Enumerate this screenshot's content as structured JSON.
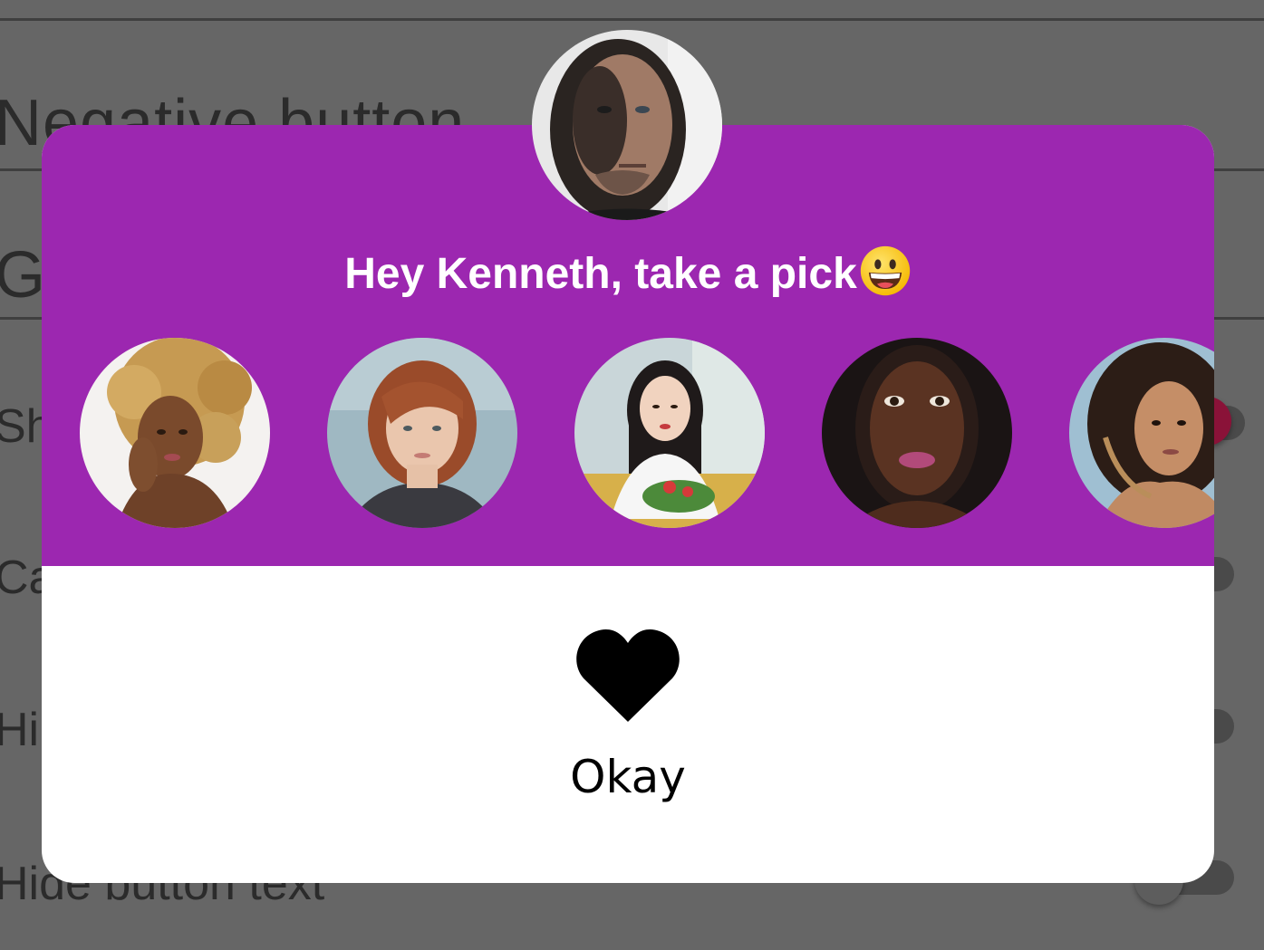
{
  "background": {
    "fields": [
      {
        "text": "Negative button"
      },
      {
        "text": "Go"
      }
    ],
    "rows": [
      {
        "label": "Sh",
        "toggle_on": true
      },
      {
        "label": "Ca",
        "toggle_on": false
      },
      {
        "label": "Hi",
        "toggle_on": false
      },
      {
        "label": "Hide button text",
        "toggle_on": false
      }
    ]
  },
  "dialog": {
    "header_color": "#9c27b0",
    "avatar_icon": "man-portrait",
    "title": "Hey Kenneth, take a pick",
    "title_emoji": "grinning-face-emoji",
    "choices": [
      {
        "name": "choice-1",
        "icon": "woman-curly-blonde-portrait"
      },
      {
        "name": "choice-2",
        "icon": "woman-red-bob-portrait"
      },
      {
        "name": "choice-3",
        "icon": "woman-dark-hair-portrait"
      },
      {
        "name": "choice-4",
        "icon": "woman-dark-skin-portrait"
      },
      {
        "name": "choice-5",
        "icon": "woman-dark-curly-portrait"
      }
    ],
    "action": {
      "icon": "heart-icon",
      "label": "Okay"
    }
  }
}
